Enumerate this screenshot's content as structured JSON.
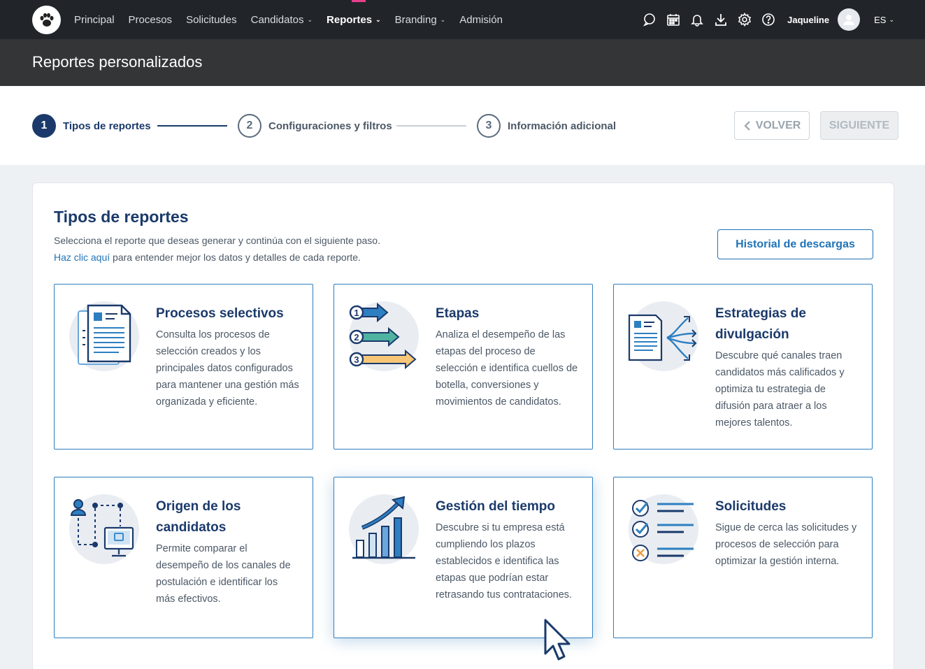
{
  "nav": {
    "items": [
      {
        "label": "Principal",
        "dropdown": false,
        "active": false
      },
      {
        "label": "Procesos",
        "dropdown": false,
        "active": false
      },
      {
        "label": "Solicitudes",
        "dropdown": false,
        "active": false
      },
      {
        "label": "Candidatos",
        "dropdown": true,
        "active": false
      },
      {
        "label": "Reportes",
        "dropdown": true,
        "active": true
      },
      {
        "label": "Branding",
        "dropdown": true,
        "active": false
      },
      {
        "label": "Admisión",
        "dropdown": false,
        "active": false
      }
    ],
    "icons": [
      "chat-icon",
      "calendar-icon",
      "bell-icon",
      "download-icon",
      "gear-icon",
      "help-icon"
    ],
    "user_name": "Jaqueline",
    "language": "ES"
  },
  "page": {
    "title": "Reportes personalizados"
  },
  "stepper": {
    "steps": [
      {
        "number": "1",
        "label": "Tipos de reportes",
        "active": true
      },
      {
        "number": "2",
        "label": "Configuraciones y filtros",
        "active": false
      },
      {
        "number": "3",
        "label": "Información adicional",
        "active": false
      }
    ],
    "back_label": "VOLVER",
    "next_label": "SIGUIENTE"
  },
  "panel": {
    "title": "Tipos de reportes",
    "description": "Selecciona el reporte que deseas generar y continúa con el siguiente paso.",
    "help_link": "Haz clic aquí",
    "help_suffix": " para entender mejor los datos y detalles de cada reporte.",
    "history_button": "Historial de descargas"
  },
  "cards": [
    {
      "title": "Procesos selectivos",
      "text": "Consulta los procesos de selección creados y los principales datos configurados para mantener una gestión más organizada y eficiente.",
      "icon": "document-icon"
    },
    {
      "title": "Etapas",
      "text": "Analiza el desempeño de las etapas del proceso de selección e identifica cuellos de botella, conversiones y movimientos de candidatos.",
      "icon": "stages-arrows-icon"
    },
    {
      "title": "Estrategias de divulgación",
      "text": "Descubre qué canales traen candidatos más calificados y optimiza tu estrategia de difusión para atraer a los mejores talentos.",
      "icon": "broadcast-icon"
    },
    {
      "title": "Origen de los candidatos",
      "text": "Permite comparar el desempeño de los canales de postulación e identificar los más efectivos.",
      "icon": "candidate-origin-icon"
    },
    {
      "title": "Gestión del tiempo",
      "text": "Descubre si tu empresa está cumpliendo los plazos establecidos e identifica las etapas que podrían estar retrasando tus contrataciones.",
      "icon": "growth-chart-icon"
    },
    {
      "title": "Solicitudes",
      "text": "Sigue de cerca las solicitudes y procesos de selección para optimizar la gestión interna.",
      "icon": "checklist-icon"
    }
  ],
  "colors": {
    "nav_bg": "#212529",
    "title_bg": "#333537",
    "brand_dark": "#1b3a6b",
    "accent": "#1f73b7",
    "active_mark": "#e83e8c"
  }
}
